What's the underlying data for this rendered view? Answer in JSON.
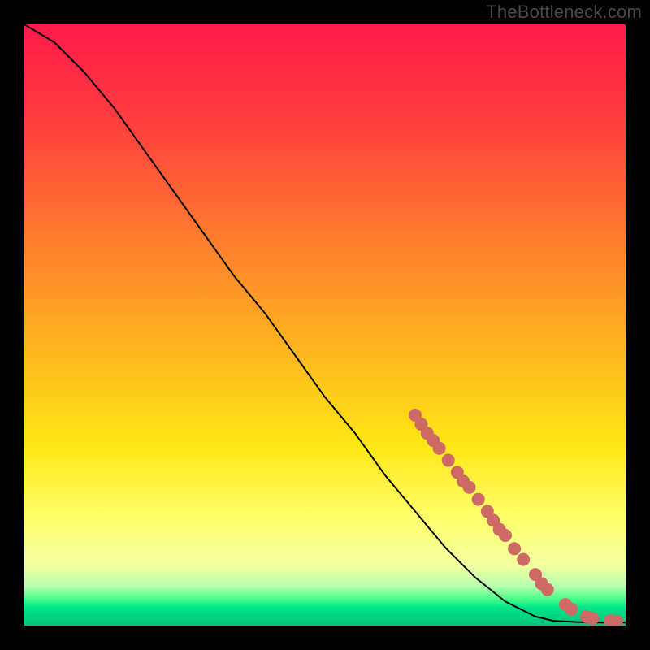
{
  "watermark": "TheBottleneck.com",
  "colors": {
    "frame": "#000000",
    "curve": "#000000",
    "marker_fill": "#cd6a66",
    "marker_stroke": "#cd6a66",
    "gradient_stops": [
      {
        "offset": 0.0,
        "color": "#ff1a4b"
      },
      {
        "offset": 0.15,
        "color": "#ff3a3f"
      },
      {
        "offset": 0.35,
        "color": "#ff7a2e"
      },
      {
        "offset": 0.55,
        "color": "#ffb81f"
      },
      {
        "offset": 0.7,
        "color": "#ffe614"
      },
      {
        "offset": 0.82,
        "color": "#ffff6a"
      },
      {
        "offset": 0.9,
        "color": "#f2ffa0"
      },
      {
        "offset": 0.935,
        "color": "#b8ffb0"
      },
      {
        "offset": 0.955,
        "color": "#4aff8a"
      },
      {
        "offset": 0.97,
        "color": "#00e68a"
      },
      {
        "offset": 1.0,
        "color": "#00c47a"
      }
    ]
  },
  "chart_data": {
    "type": "line",
    "title": "",
    "xlabel": "",
    "ylabel": "",
    "xlim": [
      0,
      100
    ],
    "ylim": [
      0,
      100
    ],
    "curve": [
      {
        "x": 0,
        "y": 100
      },
      {
        "x": 5,
        "y": 97
      },
      {
        "x": 10,
        "y": 92
      },
      {
        "x": 15,
        "y": 86
      },
      {
        "x": 20,
        "y": 79
      },
      {
        "x": 25,
        "y": 72
      },
      {
        "x": 30,
        "y": 65
      },
      {
        "x": 35,
        "y": 58
      },
      {
        "x": 40,
        "y": 52
      },
      {
        "x": 45,
        "y": 45
      },
      {
        "x": 50,
        "y": 38
      },
      {
        "x": 55,
        "y": 32
      },
      {
        "x": 60,
        "y": 25
      },
      {
        "x": 65,
        "y": 19
      },
      {
        "x": 70,
        "y": 13
      },
      {
        "x": 75,
        "y": 8
      },
      {
        "x": 80,
        "y": 4
      },
      {
        "x": 85,
        "y": 1.5
      },
      {
        "x": 88,
        "y": 0.8
      },
      {
        "x": 92,
        "y": 0.6
      },
      {
        "x": 96,
        "y": 0.5
      },
      {
        "x": 100,
        "y": 0.5
      }
    ],
    "markers": [
      {
        "x": 65,
        "y": 35
      },
      {
        "x": 66,
        "y": 33.5
      },
      {
        "x": 67,
        "y": 32
      },
      {
        "x": 68,
        "y": 30.8
      },
      {
        "x": 69,
        "y": 29.5
      },
      {
        "x": 70.5,
        "y": 27.5
      },
      {
        "x": 72,
        "y": 25.5
      },
      {
        "x": 73,
        "y": 24
      },
      {
        "x": 74,
        "y": 23
      },
      {
        "x": 75.5,
        "y": 21
      },
      {
        "x": 77,
        "y": 19
      },
      {
        "x": 78,
        "y": 17.5
      },
      {
        "x": 79,
        "y": 16
      },
      {
        "x": 80,
        "y": 15
      },
      {
        "x": 81.5,
        "y": 12.8
      },
      {
        "x": 83,
        "y": 11
      },
      {
        "x": 85,
        "y": 8.5
      },
      {
        "x": 86,
        "y": 7
      },
      {
        "x": 87,
        "y": 6
      },
      {
        "x": 90,
        "y": 3.5
      },
      {
        "x": 91,
        "y": 2.7
      },
      {
        "x": 93.5,
        "y": 1.5
      },
      {
        "x": 94.5,
        "y": 1.2
      },
      {
        "x": 97.5,
        "y": 0.8
      },
      {
        "x": 98.5,
        "y": 0.7
      }
    ]
  }
}
